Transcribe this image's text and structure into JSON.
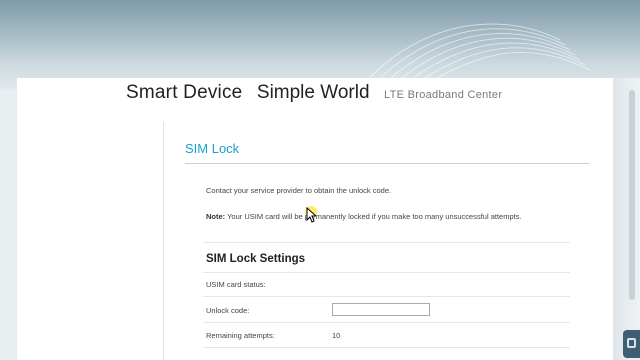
{
  "header": {
    "brand_part1": "Smart Device",
    "brand_part2": "Simple World",
    "subtitle": "LTE  Broadband  Center"
  },
  "page": {
    "title": "SIM Lock",
    "instructions": "Contact your service provider to obtain the unlock code.",
    "note_label": "Note:",
    "note_text": " Your USIM card will be permanently locked if you make too many unsuccessful attempts."
  },
  "settings": {
    "section_title": "SIM Lock Settings",
    "usim_status_label": "USIM card status:",
    "usim_status_value": "",
    "unlock_code_label": "Unlock code:",
    "unlock_code_value": "",
    "remaining_attempts_label": "Remaining attempts:",
    "remaining_attempts_value": "10"
  },
  "colors": {
    "title_blue": "#1a9fd0",
    "cursor_highlight": "#ffe650"
  },
  "icons": {
    "cursor": "mouse-pointer-icon",
    "corner": "page-icon"
  }
}
